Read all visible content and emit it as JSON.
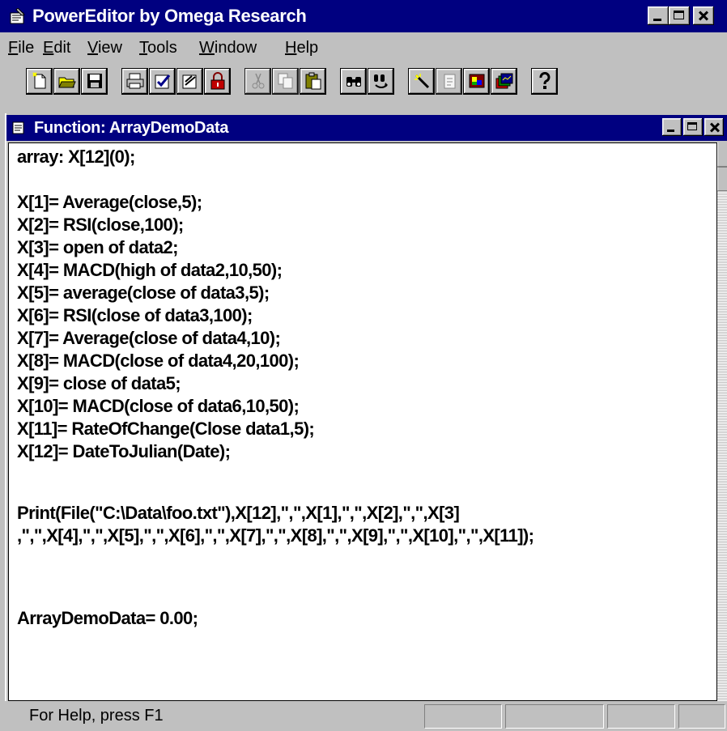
{
  "app": {
    "title": "PowerEditor by Omega Research"
  },
  "menu": {
    "items": [
      {
        "first": "F",
        "rest": "ile"
      },
      {
        "first": "E",
        "rest": "dit"
      },
      {
        "first": "V",
        "rest": "iew"
      },
      {
        "first": "T",
        "rest": "ools"
      },
      {
        "first": "W",
        "rest": "indow"
      },
      {
        "first": "H",
        "rest": "elp"
      }
    ]
  },
  "toolbar": {
    "buttons": [
      {
        "icon": "new-document-icon",
        "enabled": true
      },
      {
        "icon": "open-folder-icon",
        "enabled": true
      },
      {
        "icon": "save-disk-icon",
        "enabled": true
      },
      {
        "icon": "print-icon",
        "enabled": true
      },
      {
        "icon": "verify-icon",
        "enabled": true
      },
      {
        "icon": "verify-all-icon",
        "enabled": true
      },
      {
        "icon": "protect-lock-icon",
        "enabled": true
      },
      {
        "icon": "cut-icon",
        "enabled": false
      },
      {
        "icon": "copy-icon",
        "enabled": false
      },
      {
        "icon": "paste-icon",
        "enabled": true
      },
      {
        "icon": "find-icon",
        "enabled": true
      },
      {
        "icon": "find-replace-icon",
        "enabled": true
      },
      {
        "icon": "wizard-wand-icon",
        "enabled": true
      },
      {
        "icon": "inserter-icon",
        "enabled": false
      },
      {
        "icon": "dictionary-icon",
        "enabled": true
      },
      {
        "icon": "chart-window-icon",
        "enabled": true
      },
      {
        "icon": "help-icon",
        "enabled": true
      }
    ]
  },
  "document": {
    "title": "Function: ArrayDemoData",
    "lines": [
      "array: X[12](0);",
      "",
      "X[1]= Average(close,5);",
      "X[2]= RSI(close,100);",
      "X[3]= open of data2;",
      "X[4]= MACD(high of data2,10,50);",
      "X[5]= average(close of data3,5);",
      "X[6]= RSI(close of data3,100);",
      "X[7]= Average(close of data4,10);",
      "X[8]= MACD(close of data4,20,100);",
      "X[9]= close of data5;",
      "X[10]= MACD(close of data6,10,50);",
      "X[11]= RateOfChange(Close data1,5);",
      "X[12]= DateToJulian(Date);",
      "",
      "Print(File(\"C:\\Data\\foo.txt\"),X[12],\",\",X[1],\",\",X[2],\",\",X[3]",
      ",\",\",X[4],\",\",X[5],\",\",X[6],\",\",X[7],\",\",X[8],\",\",X[9],\",\",X[10],\",\",X[11]);",
      "",
      "",
      "ArrayDemoData= 0.00;"
    ]
  },
  "status": {
    "text": "For Help, press F1"
  },
  "colors": {
    "titlebar": "#000080",
    "face": "#c0c0c0",
    "editor_bg": "#ffffff"
  }
}
